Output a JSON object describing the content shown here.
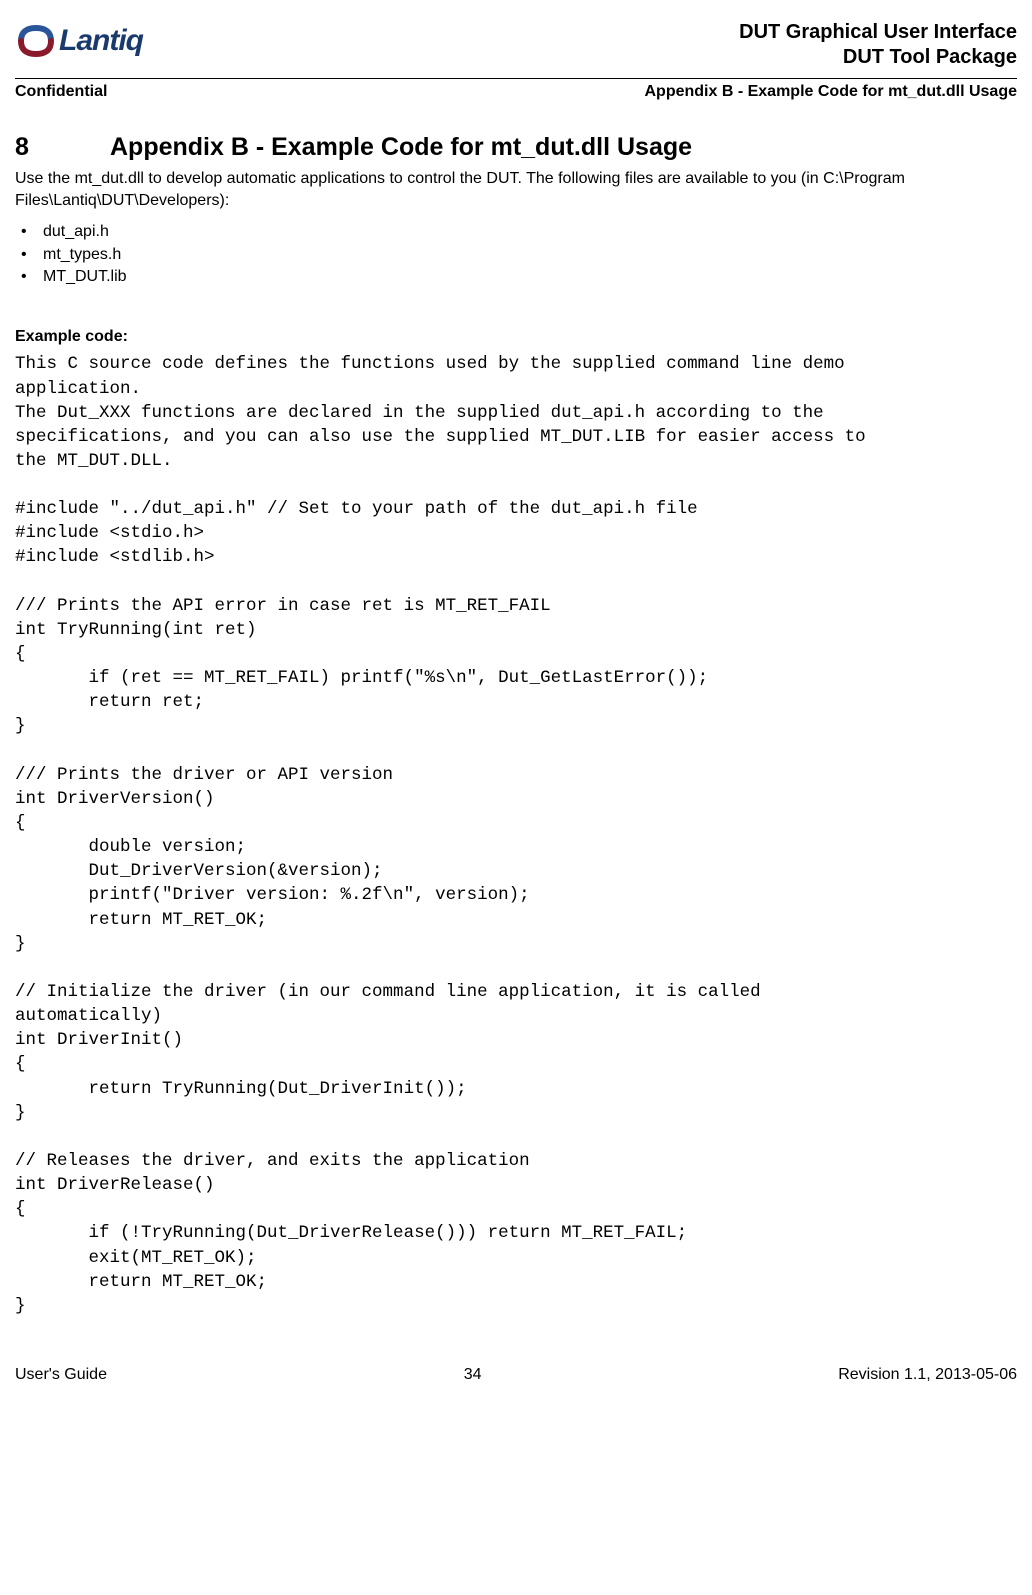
{
  "header": {
    "logo_text": "Lantiq",
    "title_line1": "DUT Graphical User Interface",
    "title_line2": "DUT Tool Package",
    "confidential": "Confidential",
    "appendix_ref": "Appendix B - Example Code for mt_dut.dll Usage"
  },
  "section": {
    "number": "8",
    "title": "Appendix B - Example Code for mt_dut.dll Usage",
    "intro": "Use the mt_dut.dll to develop automatic applications to control the DUT. The following files are available to you (in C:\\Program Files\\Lantiq\\DUT\\Developers):",
    "bullets": {
      "b0": "dut_api.h",
      "b1": "mt_types.h",
      "b2": "MT_DUT.lib"
    },
    "example_label": "Example code:",
    "code": "This C source code defines the functions used by the supplied command line demo\napplication.\nThe Dut_XXX functions are declared in the supplied dut_api.h according to the\nspecifications, and you can also use the supplied MT_DUT.LIB for easier access to\nthe MT_DUT.DLL.\n\n#include \"../dut_api.h\" // Set to your path of the dut_api.h file\n#include <stdio.h>\n#include <stdlib.h>\n\n/// Prints the API error in case ret is MT_RET_FAIL\nint TryRunning(int ret)\n{\n       if (ret == MT_RET_FAIL) printf(\"%s\\n\", Dut_GetLastError());\n       return ret;\n}\n\n/// Prints the driver or API version\nint DriverVersion()\n{\n       double version;\n       Dut_DriverVersion(&version);\n       printf(\"Driver version: %.2f\\n\", version);\n       return MT_RET_OK;\n}\n\n// Initialize the driver (in our command line application, it is called\nautomatically)\nint DriverInit()\n{\n       return TryRunning(Dut_DriverInit());\n}\n\n// Releases the driver, and exits the application\nint DriverRelease()\n{\n       if (!TryRunning(Dut_DriverRelease())) return MT_RET_FAIL;\n       exit(MT_RET_OK);\n       return MT_RET_OK;\n}"
  },
  "footer": {
    "left": "User's Guide",
    "center": "34",
    "right": "Revision 1.1, 2013-05-06"
  }
}
